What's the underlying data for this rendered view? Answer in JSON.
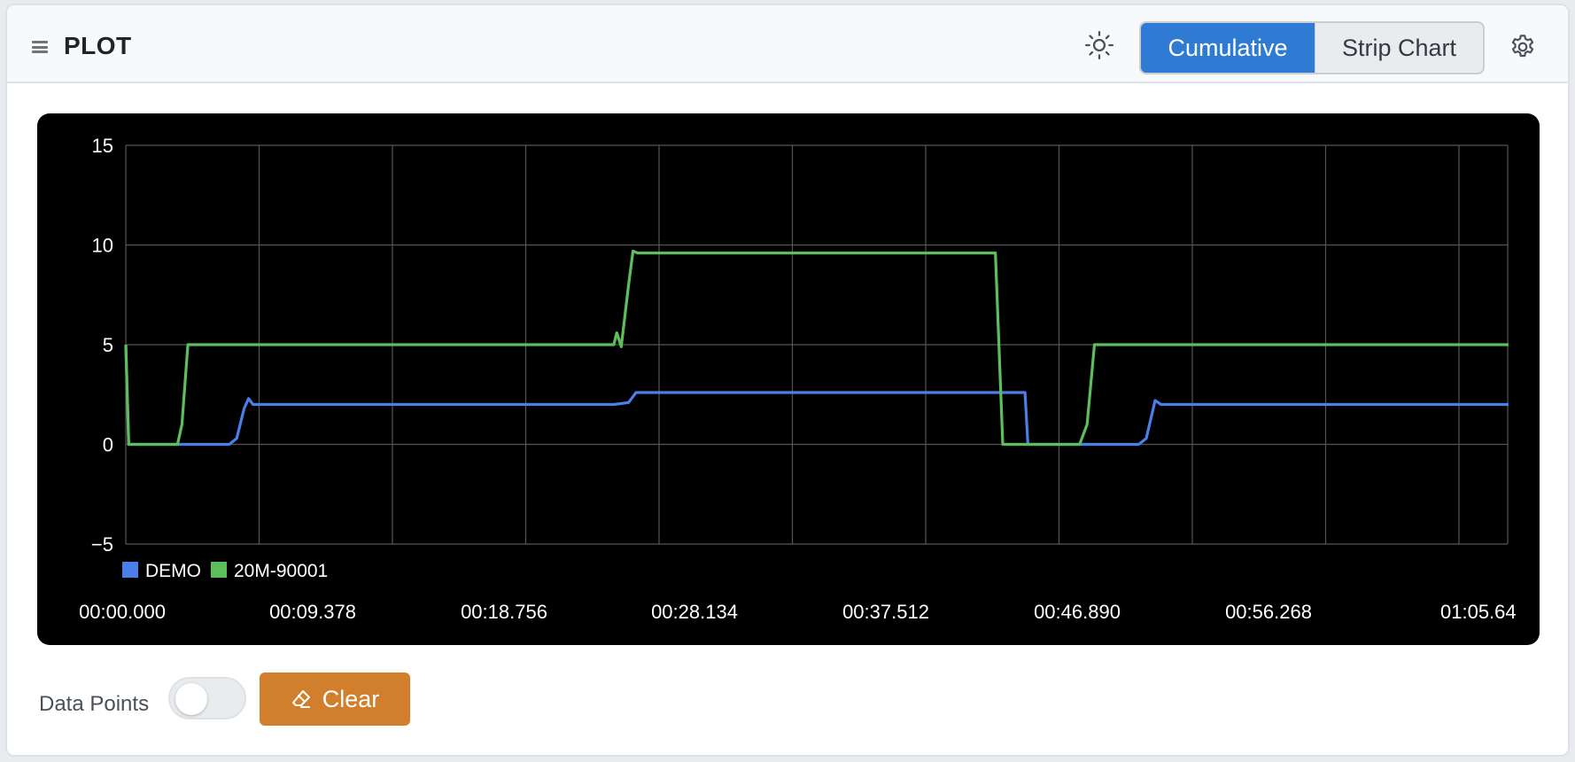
{
  "header": {
    "title": "PLOT",
    "modes": [
      {
        "label": "Cumulative",
        "active": true
      },
      {
        "label": "Strip Chart",
        "active": false
      }
    ]
  },
  "footer": {
    "data_points_label": "Data Points",
    "data_points_on": false,
    "clear_label": "Clear"
  },
  "colors": {
    "accent": "#2f7bd4",
    "clear": "#d17f2c",
    "plot_bg": "#000000"
  },
  "chart_data": {
    "type": "line",
    "ylim": [
      -5,
      15
    ],
    "yticks": [
      "15",
      "10",
      "5",
      "0",
      "−5"
    ],
    "xlim": [
      0,
      65.646
    ],
    "xticks": [
      "00:00.000",
      "00:09.378",
      "00:18.756",
      "00:28.134",
      "00:37.512",
      "00:46.890",
      "00:56.268",
      "01:05.64"
    ],
    "grid": true,
    "legend": "bottom-left",
    "series": [
      {
        "name": "DEMO",
        "color": "#4a7ee8",
        "points": [
          [
            0,
            5
          ],
          [
            0.2,
            0
          ],
          [
            7,
            0
          ],
          [
            7.5,
            0.3
          ],
          [
            8,
            1.8
          ],
          [
            8.3,
            2.3
          ],
          [
            8.6,
            2
          ],
          [
            33,
            2
          ],
          [
            34,
            2.1
          ],
          [
            34.5,
            2.6
          ],
          [
            60,
            2.6
          ],
          [
            60.8,
            2.6
          ],
          [
            61,
            0
          ],
          [
            68.5,
            0
          ],
          [
            69,
            0.3
          ],
          [
            69.6,
            2.2
          ],
          [
            70,
            2
          ],
          [
            93.5,
            2
          ]
        ]
      },
      {
        "name": "20M-90001",
        "color": "#5cbf5c",
        "points": [
          [
            0,
            5
          ],
          [
            0.2,
            0
          ],
          [
            3.5,
            0
          ],
          [
            3.8,
            1
          ],
          [
            4.2,
            5
          ],
          [
            33,
            5
          ],
          [
            33.2,
            5.6
          ],
          [
            33.5,
            4.9
          ],
          [
            34,
            8
          ],
          [
            34.3,
            9.7
          ],
          [
            34.6,
            9.6
          ],
          [
            58.5,
            9.6
          ],
          [
            58.8,
            9.6
          ],
          [
            59.3,
            0
          ],
          [
            64.5,
            0
          ],
          [
            65,
            1
          ],
          [
            65.5,
            5
          ],
          [
            93.5,
            5
          ]
        ]
      }
    ]
  }
}
